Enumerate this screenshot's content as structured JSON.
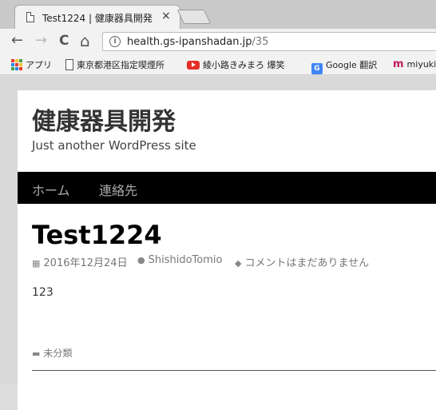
{
  "browser": {
    "tab_title": "Test1224 | 健康器具開発",
    "tab_close": "×",
    "back": "←",
    "forward": "→",
    "reload": "C",
    "home": "⌂",
    "url_host": "health.gs-ipanshadan.jp",
    "url_path": "/35"
  },
  "bookmarks": [
    {
      "label": "アプリ",
      "icon": "apps-icon"
    },
    {
      "label": "東京都港区指定喫煙所",
      "icon": "page-icon"
    },
    {
      "label": "綾小路きみまろ 爆笑",
      "icon": "youtube-icon"
    },
    {
      "label": "Google 翻訳",
      "icon": "google-translate-icon"
    },
    {
      "label": "miyuki",
      "icon": "m-icon"
    }
  ],
  "site": {
    "title": "健康器具開発",
    "description": "Just another WordPress site",
    "nav": [
      "ホーム",
      "連絡先"
    ]
  },
  "post": {
    "title": "Test1224",
    "date": "2016年12月24日",
    "author": "ShishidoTomio",
    "comments": "コメントはまだありません",
    "body": "123",
    "category": "未分類"
  }
}
